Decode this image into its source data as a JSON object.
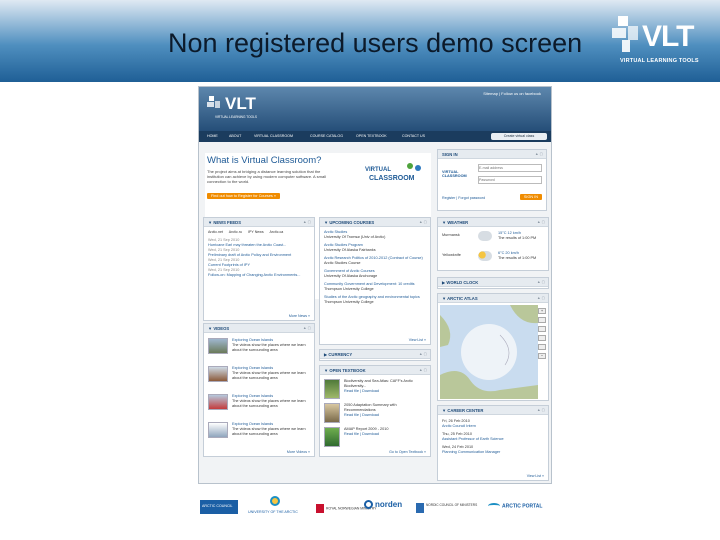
{
  "slide": {
    "title": "Non registered users demo screen",
    "brand": "VLT",
    "brand_sub": "VIRTUAL LEARNING TOOLS"
  },
  "site": {
    "brand": "VLT",
    "brand_sub": "VIRTUAL LEARNING TOOLS",
    "top_links": "Sitemap  |  Follow us on facebook",
    "nav": [
      "HOME",
      "ABOUT",
      "VIRTUAL CLASSROOM",
      "COURSE CATALOG",
      "OPEN TEXTBOOK",
      "CONTACT US"
    ],
    "nav_button": "Create virtual class",
    "hero": {
      "title": "What is Virtual Classroom?",
      "text": "The project aims at bridging a distance learning solution that the institution can achieve by using modern computer software. A small connection to the world.",
      "button": "Find out how to Register for Courses »",
      "vc_logo_top": "VIRTUAL",
      "vc_logo_bottom": "CLASSROOM"
    },
    "signin": {
      "title": "SIGN IN",
      "email_placeholder": "E-mail address",
      "password_placeholder": "Password",
      "register": "Register  |  Forgot password",
      "button": "SIGN IN",
      "logo_text": "VIRTUAL CLASSROOM"
    },
    "news": {
      "title": "NEWS FEEDS",
      "tabs": [
        "Arctic.net",
        "Arctic.ru",
        "IPY News",
        "Arctic.ca"
      ],
      "items": [
        {
          "date": "Wed, 21 Sep 2010",
          "text": "Hurricane Earl may threaten the Arctic Coast..."
        },
        {
          "date": "Wed, 21 Sep 2010",
          "text": "Preliminary draft of Arctic Policy and Environment"
        },
        {
          "date": "Wed, 21 Sep 2010",
          "text": "Current Footprints of IPY"
        },
        {
          "date": "Wed, 21 Sep 2010",
          "text": "Follow-on: Mapping of Changing Arctic Environments..."
        }
      ],
      "more": "More News »"
    },
    "videos": {
      "title": "VIDEOS",
      "items": [
        {
          "title": "Exploring Ocean Islands",
          "text": "The videos show the places where we learn about the surrounding area"
        },
        {
          "title": "Exploring Ocean Islands",
          "text": "The videos show the places where we learn about the surrounding area"
        },
        {
          "title": "Exploring Ocean Islands",
          "text": "The videos show the places where we learn about the surrounding area"
        },
        {
          "title": "Exploring Ocean Islands",
          "text": "The videos show the places where we learn about the surrounding area"
        }
      ],
      "more": "More Videos »"
    },
    "courses": {
      "title": "UPCOMING COURSES",
      "items": [
        {
          "name": "Arctic Studies",
          "org": "University Of Tromsø (Univ of Arctic)"
        },
        {
          "name": "Arctic Studies Program",
          "org": "University Of Alaska Fairbanks"
        },
        {
          "name": "Arctic Research Politics of 2010-2012 (Contract of Course)",
          "org": "Arctic Studies Course"
        },
        {
          "name": "Government of Arctic Courses",
          "org": "University Of Alaska Anchorage"
        },
        {
          "name": "Community Government and Development: 10 credits",
          "org": "Thompson University College"
        },
        {
          "name": "Studies of the Arctic geography and environmental topics",
          "org": "Thompson University College"
        }
      ],
      "more": "View List »"
    },
    "currency": {
      "title": "CURRENCY"
    },
    "textbook": {
      "title": "OPEN TEXTBOOK",
      "items": [
        {
          "title": "Biodiversity and Sea Atlas: CAFF's Arctic Biodiversity...",
          "links": "Read file  |  Download"
        },
        {
          "title": "2050 Adaptation Summary with Recommendations",
          "links": "Read file  |  Download"
        },
        {
          "title": "AMAP Report 2009 - 2010",
          "links": "Read file  |  Download"
        }
      ],
      "more": "Go to Open Textbook »"
    },
    "weather": {
      "title": "WEATHER",
      "rows": [
        {
          "city": "Murmansk",
          "temp": "15°C  12 km/h",
          "time": "The results of 1:00 PM"
        },
        {
          "city": "Yellowknife",
          "temp": "6°C  20 km/h",
          "time": "The results of 1:00 PM"
        }
      ]
    },
    "worldclock": {
      "title": "WORLD CLOCK"
    },
    "atlas": {
      "title": "ARCTIC ATLAS"
    },
    "career": {
      "title": "CAREER CENTER",
      "items": [
        {
          "date": "Fri, 26 Feb 2010",
          "text": "Arctic Council Intern"
        },
        {
          "date": "Thu, 25 Feb 2010",
          "text": "Assistant Professor of Earth Science"
        },
        {
          "date": "Wed, 24 Feb 2010",
          "text": "Planning Communication Manager"
        }
      ],
      "more": "View List »"
    }
  },
  "partners": [
    "ARCTIC COUNCIL",
    "UNIVERSITY OF THE ARCTIC",
    "ROYAL NORWEGIAN MINISTRY",
    "norden",
    "NORDIC COUNCIL OF MINISTERS",
    "ARCTIC PORTAL"
  ],
  "colors": {
    "header_dark": "#1f5f96",
    "site_blue": "#1e5a96",
    "orange": "#f08c00"
  }
}
